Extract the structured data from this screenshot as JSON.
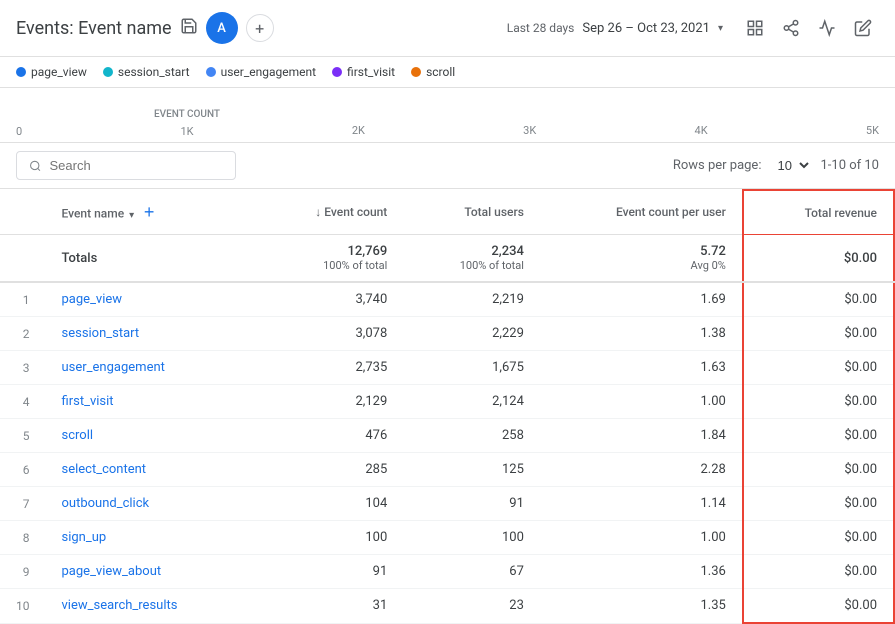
{
  "header": {
    "title": "Events: Event name",
    "avatar_initial": "A",
    "last_days_label": "Last 28 days",
    "date_range": "Sep 26 – Oct 23, 2021",
    "save_icon": "💾",
    "share_icon": "⬆",
    "trend_icon": "📈",
    "edit_icon": "✏"
  },
  "legend": {
    "items": [
      {
        "label": "page_view",
        "color": "#1a73e8"
      },
      {
        "label": "session_start",
        "color": "#12b5cb"
      },
      {
        "label": "user_engagement",
        "color": "#4285f4"
      },
      {
        "label": "first_visit",
        "color": "#7b2ff7"
      },
      {
        "label": "scroll",
        "color": "#e8710a"
      }
    ]
  },
  "chart": {
    "axis_labels": [
      "0",
      "1K",
      "2K",
      "3K",
      "4K",
      "5K"
    ],
    "center_label": "EVENT COUNT"
  },
  "toolbar": {
    "search_placeholder": "Search",
    "rows_label": "Rows per page:",
    "rows_value": "10",
    "pagination": "1-10 of 10"
  },
  "table": {
    "columns": [
      {
        "key": "row_num",
        "label": ""
      },
      {
        "key": "event_name",
        "label": "Event name",
        "sortable": true,
        "has_add": true
      },
      {
        "key": "event_count",
        "label": "↓ Event count",
        "sortable": true
      },
      {
        "key": "total_users",
        "label": "Total users"
      },
      {
        "key": "event_count_per_user",
        "label": "Event count per user"
      },
      {
        "key": "total_revenue",
        "label": "Total revenue",
        "highlighted": true
      }
    ],
    "totals": {
      "label": "Totals",
      "event_count": "12,769",
      "event_count_sub": "100% of total",
      "total_users": "2,234",
      "total_users_sub": "100% of total",
      "event_count_per_user": "5.72",
      "event_count_per_user_sub": "Avg 0%",
      "total_revenue": "$0.00"
    },
    "rows": [
      {
        "num": 1,
        "name": "page_view",
        "event_count": "3,740",
        "total_users": "2,219",
        "event_count_per_user": "1.69",
        "total_revenue": "$0.00"
      },
      {
        "num": 2,
        "name": "session_start",
        "event_count": "3,078",
        "total_users": "2,229",
        "event_count_per_user": "1.38",
        "total_revenue": "$0.00"
      },
      {
        "num": 3,
        "name": "user_engagement",
        "event_count": "2,735",
        "total_users": "1,675",
        "event_count_per_user": "1.63",
        "total_revenue": "$0.00"
      },
      {
        "num": 4,
        "name": "first_visit",
        "event_count": "2,129",
        "total_users": "2,124",
        "event_count_per_user": "1.00",
        "total_revenue": "$0.00"
      },
      {
        "num": 5,
        "name": "scroll",
        "event_count": "476",
        "total_users": "258",
        "event_count_per_user": "1.84",
        "total_revenue": "$0.00"
      },
      {
        "num": 6,
        "name": "select_content",
        "event_count": "285",
        "total_users": "125",
        "event_count_per_user": "2.28",
        "total_revenue": "$0.00"
      },
      {
        "num": 7,
        "name": "outbound_click",
        "event_count": "104",
        "total_users": "91",
        "event_count_per_user": "1.14",
        "total_revenue": "$0.00"
      },
      {
        "num": 8,
        "name": "sign_up",
        "event_count": "100",
        "total_users": "100",
        "event_count_per_user": "1.00",
        "total_revenue": "$0.00"
      },
      {
        "num": 9,
        "name": "page_view_about",
        "event_count": "91",
        "total_users": "67",
        "event_count_per_user": "1.36",
        "total_revenue": "$0.00"
      },
      {
        "num": 10,
        "name": "view_search_results",
        "event_count": "31",
        "total_users": "23",
        "event_count_per_user": "1.35",
        "total_revenue": "$0.00"
      }
    ]
  }
}
